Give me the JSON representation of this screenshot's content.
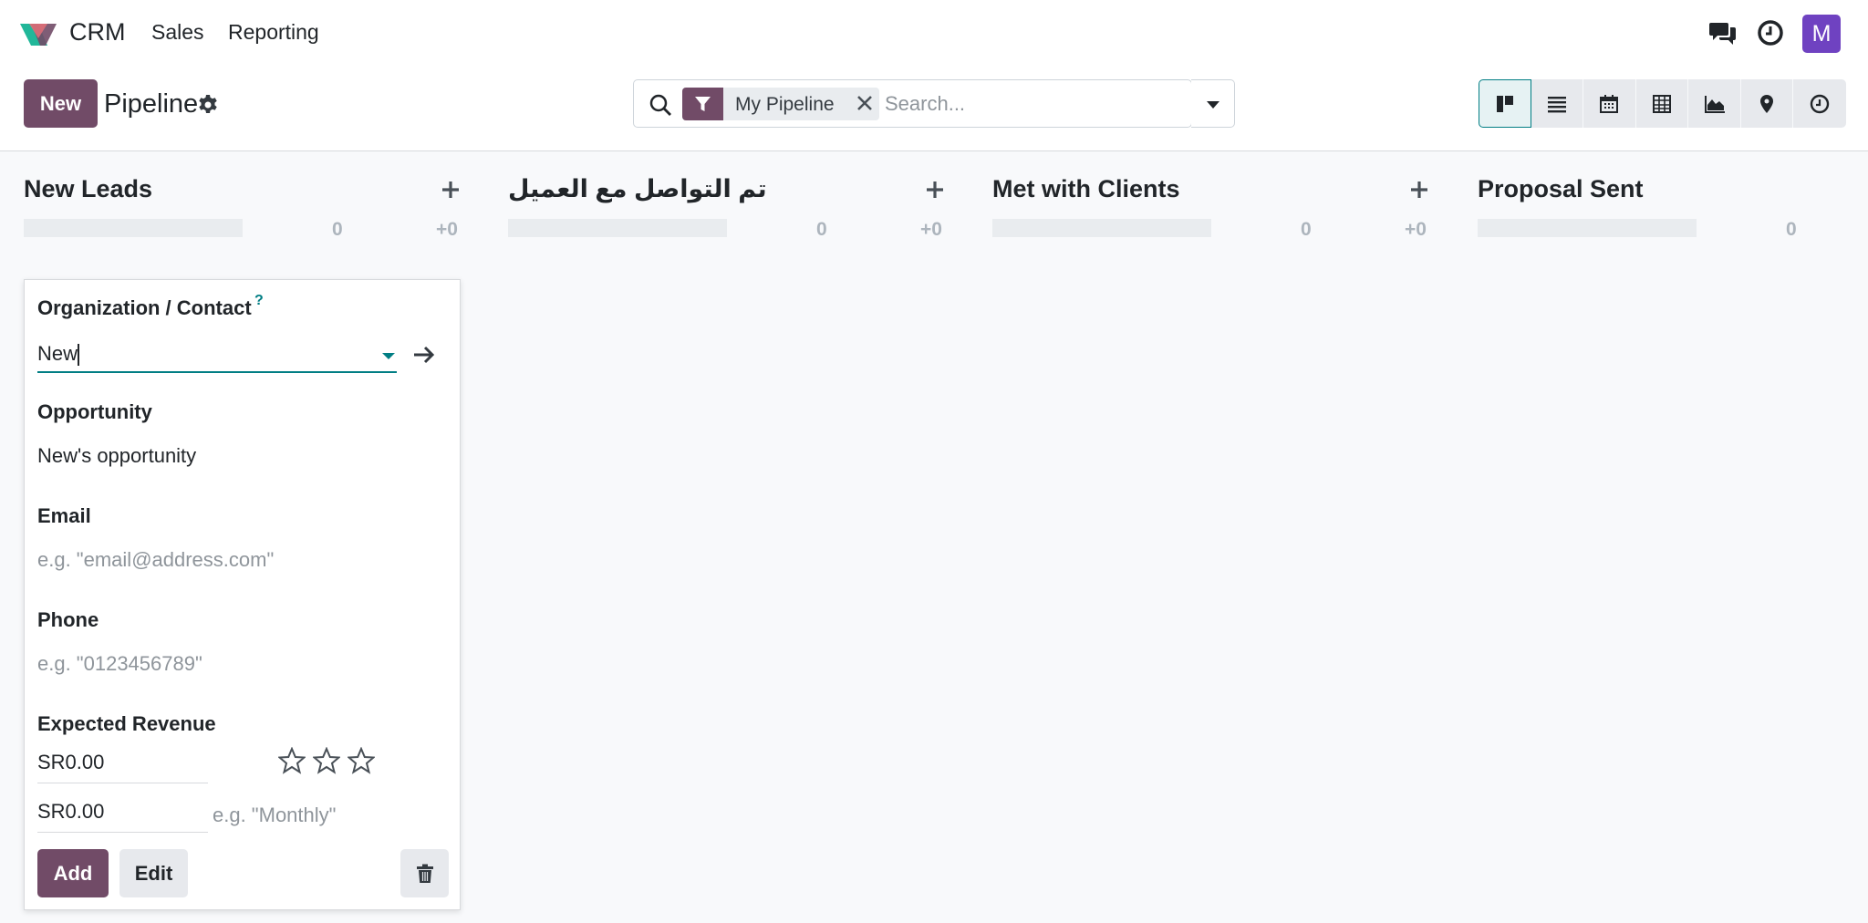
{
  "navbar": {
    "app_name": "CRM",
    "menu": [
      "Sales",
      "Reporting"
    ],
    "avatar_initial": "M"
  },
  "control": {
    "new_label": "New",
    "title": "Pipeline",
    "facet_label": "My Pipeline",
    "search_placeholder": "Search..."
  },
  "columns": [
    {
      "title": "New Leads",
      "count": "0",
      "revenue": "+0"
    },
    {
      "title": "تم التواصل مع العميل",
      "count": "0",
      "revenue": "+0"
    },
    {
      "title": "Met with Clients",
      "count": "0",
      "revenue": "+0"
    },
    {
      "title": "Proposal Sent",
      "count": "0"
    }
  ],
  "quick_create": {
    "org_label": "Organization / Contact",
    "org_help": "?",
    "org_value": "New",
    "opportunity_label": "Opportunity",
    "opportunity_value": "New's opportunity",
    "email_label": "Email",
    "email_placeholder": "e.g. \"email@address.com\"",
    "phone_label": "Phone",
    "phone_placeholder": "e.g. \"0123456789\"",
    "revenue_label": "Expected Revenue",
    "revenue_value": "SR0.00",
    "recurring_value": "SR0.00",
    "recurring_placeholder": "e.g. \"Monthly\"",
    "priority_stars": 0,
    "add_label": "Add",
    "edit_label": "Edit"
  },
  "colors": {
    "primary": "#714b67",
    "accent": "#017e84",
    "avatar": "#6f42c1"
  }
}
